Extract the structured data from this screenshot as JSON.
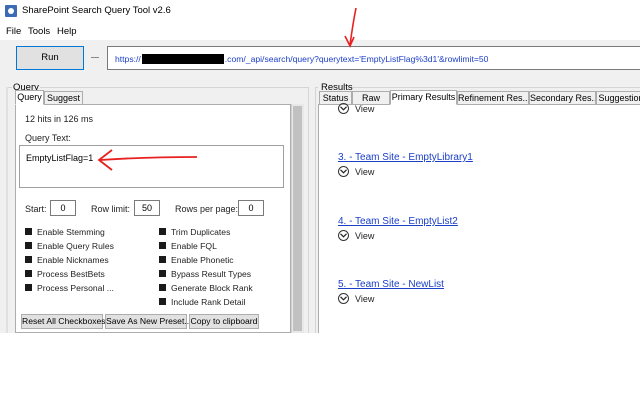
{
  "window": {
    "title": "SharePoint Search Query Tool v2.6"
  },
  "menu": [
    "File",
    "Tools",
    "Help"
  ],
  "toolbar": {
    "run_label": "Run",
    "url_prefix": "https://",
    "url_suffix": ".com/_api/search/query?querytext='EmptyListFlag%3d1'&rowlimit=50"
  },
  "query_group": {
    "label": "Query",
    "tabs": [
      {
        "label": "Query",
        "active": true
      },
      {
        "label": "Suggest",
        "active": false
      }
    ],
    "hits_text": "12 hits in 126 ms",
    "query_text_label": "Query Text:",
    "query_text_value": "EmptyListFlag=1",
    "start_label": "Start:",
    "start_value": "0",
    "row_limit_label": "Row limit:",
    "row_limit_value": "50",
    "rows_per_page_label": "Rows per page:",
    "rows_per_page_value": "0",
    "checkboxes_left": [
      "Enable Stemming",
      "Enable Query Rules",
      "Enable Nicknames",
      "Process BestBets",
      "Process Personal ..."
    ],
    "checkboxes_right": [
      "Trim Duplicates",
      "Enable FQL",
      "Enable Phonetic",
      "Bypass Result Types",
      "Generate Block Rank",
      "Include Rank Detail"
    ],
    "buttons": {
      "reset": "Reset All Checkboxes",
      "save": "Save As New Preset...",
      "copy": "Copy to clipboard"
    }
  },
  "results_group": {
    "label": "Results",
    "tabs": [
      {
        "label": "Status",
        "active": false
      },
      {
        "label": "Raw",
        "active": false
      },
      {
        "label": "Primary Results",
        "active": true
      },
      {
        "label": "Refinement Res...",
        "active": false
      },
      {
        "label": "Secondary Res...",
        "active": false
      },
      {
        "label": "Suggestion",
        "active": false
      }
    ],
    "view_label": "View",
    "items": [
      {
        "title": "3. - Team Site - EmptyLibrary1"
      },
      {
        "title": "4. - Team Site - EmptyList2"
      },
      {
        "title": "5. - Team Site - NewList"
      }
    ]
  },
  "colors": {
    "annotation": "#e8201f",
    "link": "#1a3ec7",
    "run_border": "#0078d7"
  },
  "icons": {
    "app": "sharepoint-app-icon",
    "view": "chevron-down-circle-icon"
  }
}
